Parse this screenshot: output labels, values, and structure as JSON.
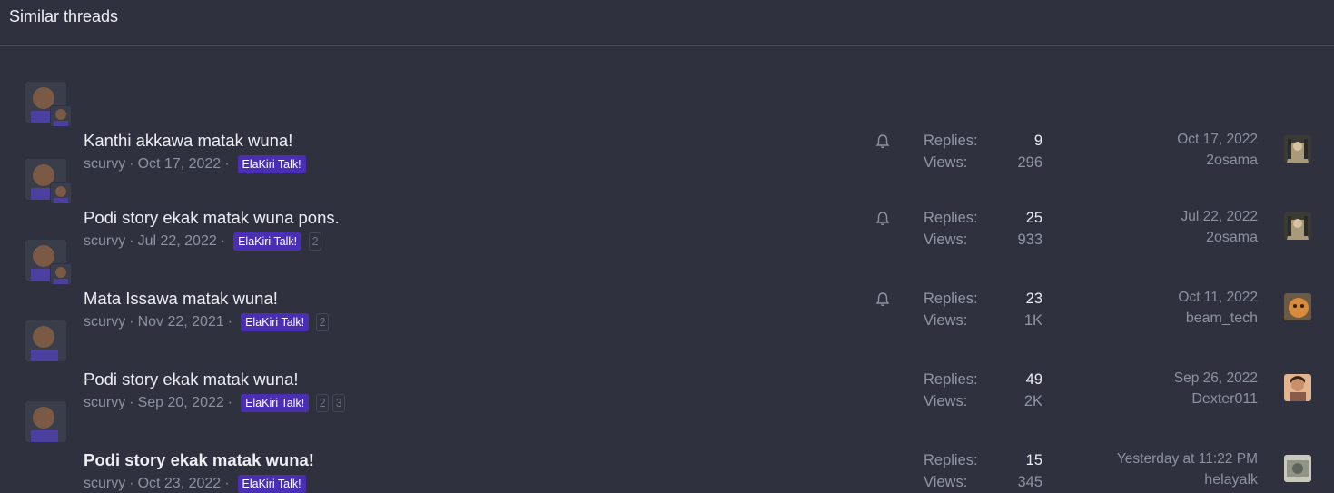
{
  "header": {
    "title": "Similar threads"
  },
  "threads": [
    {
      "title": "Kanthi akkawa matak wuna!",
      "author": "scurvy",
      "date": "Oct 17, 2022",
      "tag": "ElaKiri Talk!",
      "pages": [],
      "watched": true,
      "replies_label": "Replies:",
      "replies": "9",
      "views_label": "Views:",
      "views": "296",
      "last_date": "Oct 17, 2022",
      "last_user": "2osama",
      "unread": false
    },
    {
      "title": "Podi story ekak matak wuna pons.",
      "author": "scurvy",
      "date": "Jul 22, 2022",
      "tag": "ElaKiri Talk!",
      "pages": [
        "2"
      ],
      "watched": true,
      "replies_label": "Replies:",
      "replies": "25",
      "views_label": "Views:",
      "views": "933",
      "last_date": "Jul 22, 2022",
      "last_user": "2osama",
      "unread": false
    },
    {
      "title": "Mata Issawa matak wuna!",
      "author": "scurvy",
      "date": "Nov 22, 2021",
      "tag": "ElaKiri Talk!",
      "pages": [
        "2"
      ],
      "watched": true,
      "replies_label": "Replies:",
      "replies": "23",
      "views_label": "Views:",
      "views": "1K",
      "last_date": "Oct 11, 2022",
      "last_user": "beam_tech",
      "unread": false
    },
    {
      "title": "Podi story ekak matak wuna!",
      "author": "scurvy",
      "date": "Sep 20, 2022",
      "tag": "ElaKiri Talk!",
      "pages": [
        "2",
        "3"
      ],
      "watched": false,
      "replies_label": "Replies:",
      "replies": "49",
      "views_label": "Views:",
      "views": "2K",
      "last_date": "Sep 26, 2022",
      "last_user": "Dexter011",
      "unread": false
    },
    {
      "title": "Podi story ekak matak wuna!",
      "author": "scurvy",
      "date": "Oct 23, 2022",
      "tag": "ElaKiri Talk!",
      "pages": [],
      "watched": false,
      "replies_label": "Replies:",
      "replies": "15",
      "views_label": "Views:",
      "views": "345",
      "last_date": "Yesterday at 11:22 PM",
      "last_user": "helayalk",
      "unread": true
    }
  ],
  "colors": {
    "background": "#2f323e",
    "tag": "#4a2fb5",
    "muted": "#8b92a0"
  }
}
